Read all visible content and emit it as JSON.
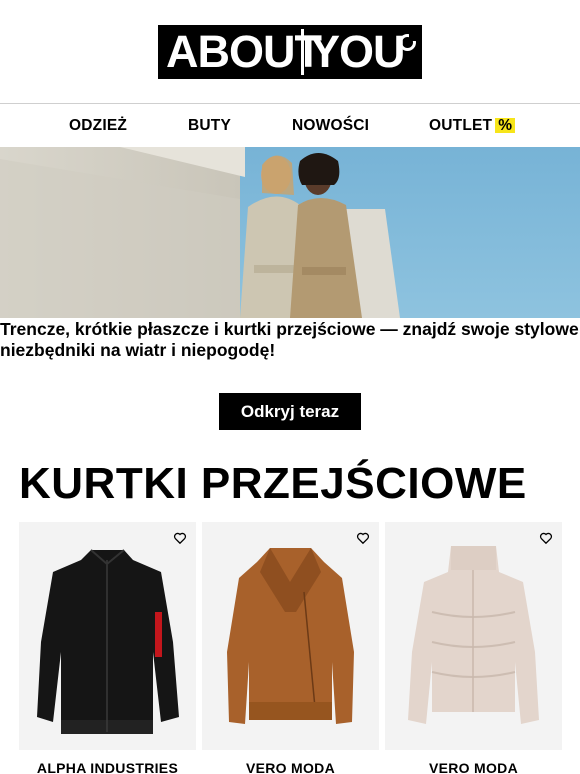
{
  "header": {
    "logo_left": "ABOUT",
    "logo_right": "YOU"
  },
  "nav": {
    "items": [
      "ODZIEŻ",
      "BUTY",
      "NOWOŚCI",
      "OUTLET"
    ],
    "outlet_badge": "%"
  },
  "hero": {
    "image": "two women in trench coats against a white wall and blue sky"
  },
  "promo": {
    "text": "Trencze, krótkie płaszcze i kurtki przejściowe — znajdź swoje stylowe niezbędniki na wiatr i niepogodę!",
    "cta_label": "Odkryj teraz"
  },
  "section": {
    "title": "KURTKI PRZEJŚCIOWE"
  },
  "products": [
    {
      "brand": "ALPHA INDUSTRIES",
      "image": "black bomber jacket",
      "icon": "heart-icon"
    },
    {
      "brand": "VERO MODA",
      "image": "brown suede biker jacket",
      "icon": "heart-icon"
    },
    {
      "brand": "VERO MODA",
      "image": "beige puffer jacket",
      "icon": "heart-icon"
    }
  ],
  "colors": {
    "accent_yellow": "#f7e51a",
    "cta_bg": "#000000",
    "sky": "#7fb8d8",
    "card_bg": "#f3f3f3"
  }
}
